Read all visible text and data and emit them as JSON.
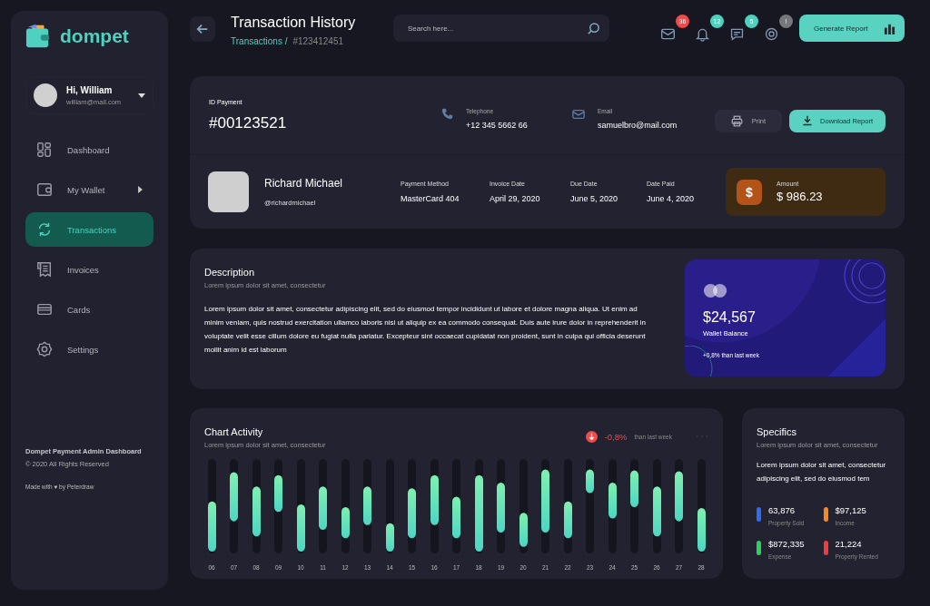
{
  "sidebar": {
    "brand": "dompet",
    "user": {
      "greeting": "Hi, William",
      "email": "william@mail.com"
    },
    "items": [
      {
        "label": "Dashboard",
        "selected": false,
        "submenu": false
      },
      {
        "label": "My Wallet",
        "selected": false,
        "submenu": true
      },
      {
        "label": "Transactions",
        "selected": true,
        "submenu": false
      },
      {
        "label": "Invoices",
        "selected": false,
        "submenu": false
      },
      {
        "label": "Cards",
        "selected": false,
        "submenu": false
      },
      {
        "label": "Settings",
        "selected": false,
        "submenu": false
      }
    ],
    "footer": {
      "title": "Dompet Payment Admin Dashboard",
      "copyright": "© 2020 All Rights Reserved",
      "credit": "Made with ♥ by Peterdraw"
    }
  },
  "header": {
    "title": "Transaction History",
    "breadcrumb": [
      "Transactions /",
      "#123412451"
    ],
    "search": {
      "placeholder": "Search here..."
    },
    "notifications": [
      {
        "count": "36",
        "color": "#f04a4a"
      },
      {
        "count": "12",
        "color": "#4fd1c0"
      },
      {
        "count": "5",
        "color": "#4fd1c0"
      },
      {
        "count": "!",
        "color": "#77777d"
      }
    ],
    "action": "Generate Report"
  },
  "payment": {
    "id_label": "ID Payment",
    "id": "#00123521",
    "telephone_label": "Telephone",
    "telephone": "+12 345 5662 66",
    "email_label": "Email",
    "email": "samuelbro@mail.com",
    "print": "Print",
    "download": "Download Report",
    "name": "Richard Michael",
    "handle": "@richardmichael",
    "details": [
      {
        "label": "Payment Method",
        "value": "MasterCard 404"
      },
      {
        "label": "Invoice Date",
        "value": "April 29, 2020"
      },
      {
        "label": "Due Date",
        "value": "June 5, 2020"
      },
      {
        "label": "Date Paid",
        "value": "June 4, 2020"
      }
    ],
    "amount_label": "Amount",
    "amount": "$ 986.23",
    "currency_symbol": "$"
  },
  "description": {
    "title": "Description",
    "subtitle": "Lorem ipsum dolor sit amet, consectetur",
    "text": "Lorem ipsum dolor sit amet, consectetur adipiscing elit, sed do eiusmod tempor incididunt ut labore et dolore magna aliqua. Ut enim ad minim veniam, quis nostrud exercitation ullamco laboris nisi ut aliquip ex ea commodo consequat. Duis aute irure dolor in reprehenderit in voluptate velit esse cillum dolore eu fugiat nulla pariatur. Excepteur sint occaecat cupidatat non proident, sunt in culpa qui officia deserunt mollit anim id est laborum"
  },
  "wallet_card": {
    "balance": "$24,567",
    "label": "Wallet Balance",
    "change": "+0,8% than last week"
  },
  "chart_activity": {
    "title": "Chart Activity",
    "subtitle": "Lorem ipsum dolor sit amet, consectetur",
    "change": "-0,8%",
    "change_note": "than last week",
    "days": [
      "06",
      "07",
      "08",
      "09",
      "10",
      "11",
      "12",
      "13",
      "14",
      "15",
      "16",
      "17",
      "18",
      "19",
      "20",
      "21",
      "22",
      "23",
      "24",
      "25",
      "26",
      "27",
      "28"
    ]
  },
  "specifics": {
    "title": "Specifics",
    "subtitle": "Lorem ipsum dolor sit amet, consectetur",
    "text": "Lorem ipsum dolor sit amet, consectetur adipiscing elit, sed do eiusmod tem",
    "stats": [
      {
        "value": "63,876",
        "label": "Property Sold",
        "color": "#2f6cf0"
      },
      {
        "value": "$97,125",
        "label": "Income",
        "color": "#f5891f"
      },
      {
        "value": "$872,335",
        "label": "Expense",
        "color": "#2fcf5f"
      },
      {
        "value": "21,224",
        "label": "Property Rented",
        "color": "#ef3d3d"
      }
    ]
  }
}
